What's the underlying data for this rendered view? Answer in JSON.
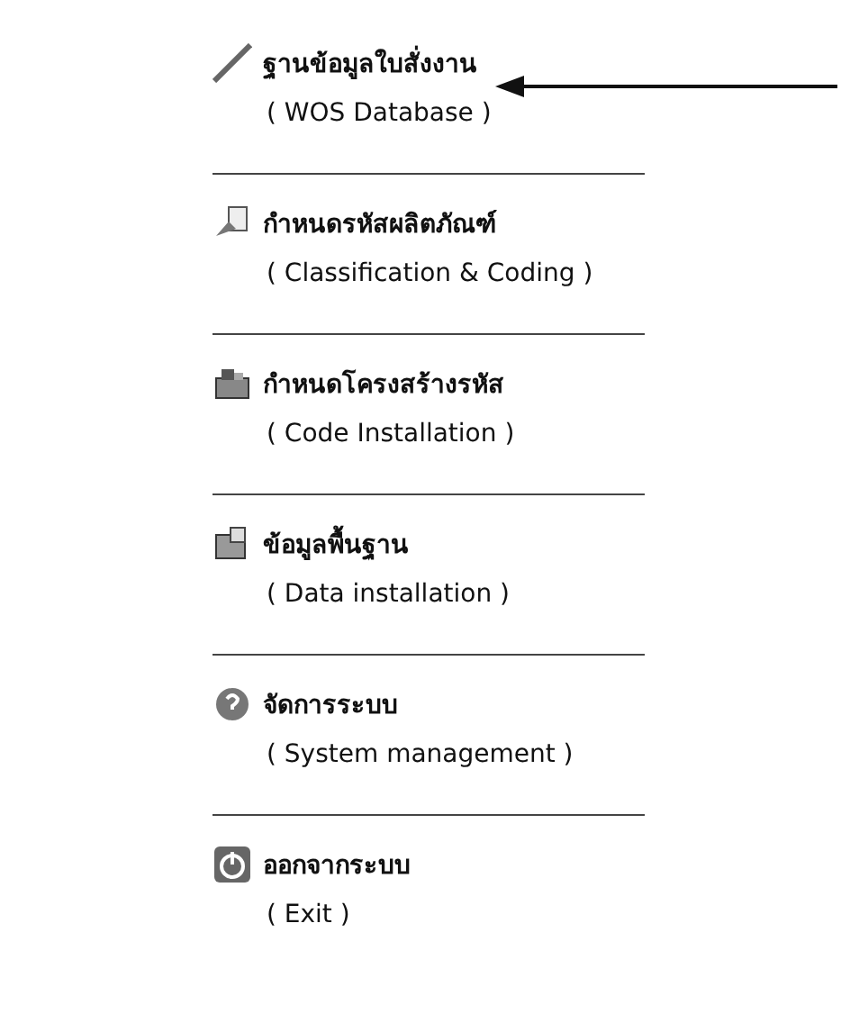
{
  "menu": [
    {
      "kind": "database",
      "title": "ฐานข้อมูลใบสั่งงาน",
      "subtitle": "( WOS Database )"
    },
    {
      "kind": "coding",
      "title": "กำหนดรหัสผลิตภัณฑ์",
      "subtitle": "( Classification & Coding )"
    },
    {
      "kind": "code",
      "title": "กำหนดโครงสร้างรหัส",
      "subtitle": "( Code Installation )"
    },
    {
      "kind": "data",
      "title": "ข้อมูลพื้นฐาน",
      "subtitle": "( Data installation )"
    },
    {
      "kind": "system",
      "title": "จัดการระบบ",
      "subtitle": "( System management )"
    },
    {
      "kind": "exit",
      "title": "ออกจากระบบ",
      "subtitle": "( Exit )"
    }
  ]
}
